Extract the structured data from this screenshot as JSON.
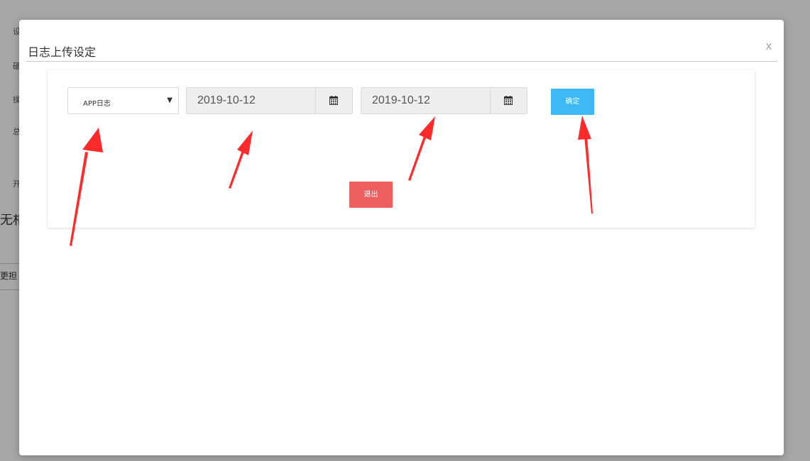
{
  "background_page": {
    "fragments": [
      "设",
      "硬",
      "操",
      "总",
      "开",
      "无相",
      "更担"
    ]
  },
  "modal": {
    "title": "日志上传设定",
    "close_label": "x"
  },
  "form": {
    "log_type": {
      "selected": "APP日志",
      "arrow": "▼"
    },
    "start_date": {
      "value": "2019-10-12",
      "icon": "calendar-icon"
    },
    "end_date": {
      "value": "2019-10-12",
      "icon": "calendar-icon"
    },
    "confirm_label": "确定",
    "exit_label": "退出"
  },
  "colors": {
    "confirm": "#3fb9f5",
    "exit": "#ee5f5f",
    "arrow": "#ff2a2a",
    "backdrop": "#a6a6a6"
  },
  "annotations": {
    "arrow_count": 4
  }
}
